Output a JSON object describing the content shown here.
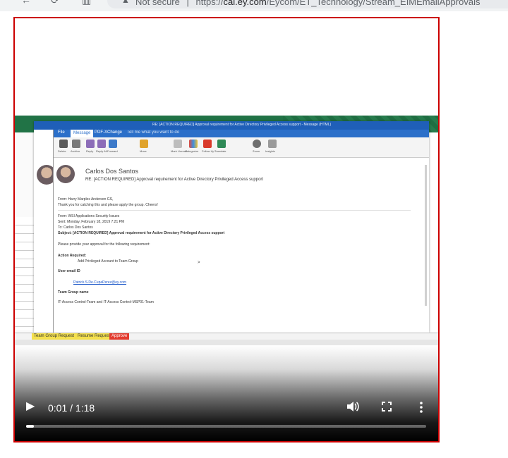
{
  "browser": {
    "security_label": "Not secure",
    "separator": "|",
    "url_prefix": "https://",
    "url_domain": "cal.ey.com",
    "url_path": "/Eycom/ET_Technology/Stream_EIMEmailApprovals"
  },
  "video": {
    "current_time": "0:01",
    "duration": "1:18",
    "time_display": "0:01 / 1:18",
    "progress": 0.02
  },
  "recording": {
    "outlook_window_title": "RE: [ACTION REQUIRED] Approval requirement for Active Directory Privileged Access support  -  Message (HTML)",
    "ribbon_tabs": [
      "File",
      "Message",
      "PDF-XChange",
      "Tell me what you want to do"
    ],
    "ribbon_buttons": [
      "Delete",
      "Archive",
      "Reply",
      "Reply All",
      "Forward",
      "Move",
      "Mark Unread",
      "Categorize",
      "Follow Up",
      "Translate",
      "Zoom",
      "Insights"
    ],
    "sender_name": "Carlos Dos Santos",
    "subject": "RE: [ACTION REQUIRED] Approval requirement for Active Directory Privileged Access support",
    "body_lines": [
      {
        "text": "From: Harry Marples Anderson GS,",
        "style": "normal"
      },
      {
        "text": "Thank you for catching this and please apply the group. Cheers!",
        "style": "normal"
      },
      {
        "text": "From: WSI Applications Security Issues",
        "style": "normal"
      },
      {
        "text": "Sent: Monday, February 18, 2019 7:21 PM",
        "style": "normal"
      },
      {
        "text": "To: Carlos Dos Santos",
        "style": "normal"
      },
      {
        "text": "Subject: [ACTION REQUIRED] Approval requirement for Active Directory Privileged Access support",
        "style": "b"
      },
      {
        "text": "Please provide your approval for the following requirement:",
        "style": "normal"
      },
      {
        "text": "Action Required:",
        "style": "b"
      },
      {
        "text": "Add Privileged Account to Team Group",
        "style": "normal"
      },
      {
        "text": "User email ID",
        "style": "b"
      },
      {
        "text": "Patrick.S.De.CupaPerez@ey.com",
        "style": "lnk"
      },
      {
        "text": "Team Group name",
        "style": "b"
      },
      {
        "text": "IT-Access Control-Team and IT-Access Control-MSP01-Team",
        "style": "normal"
      }
    ],
    "sheet_tabs": [
      "Team Group Request",
      "Resume Request",
      "Approve"
    ],
    "sheet_tab_colors": [
      "#f4e04d",
      "#f4e04d",
      "#e33b2e"
    ]
  },
  "icons": {
    "back": "arrow-left-icon",
    "reload": "reload-icon",
    "play": "play-icon",
    "volume": "volume-icon",
    "fullscreen": "fullscreen-icon",
    "menu": "more-vert-icon"
  },
  "colors": {
    "frame_border": "#cc0000",
    "excel_green": "#217346",
    "outlook_blue": "#2b6fc9"
  }
}
